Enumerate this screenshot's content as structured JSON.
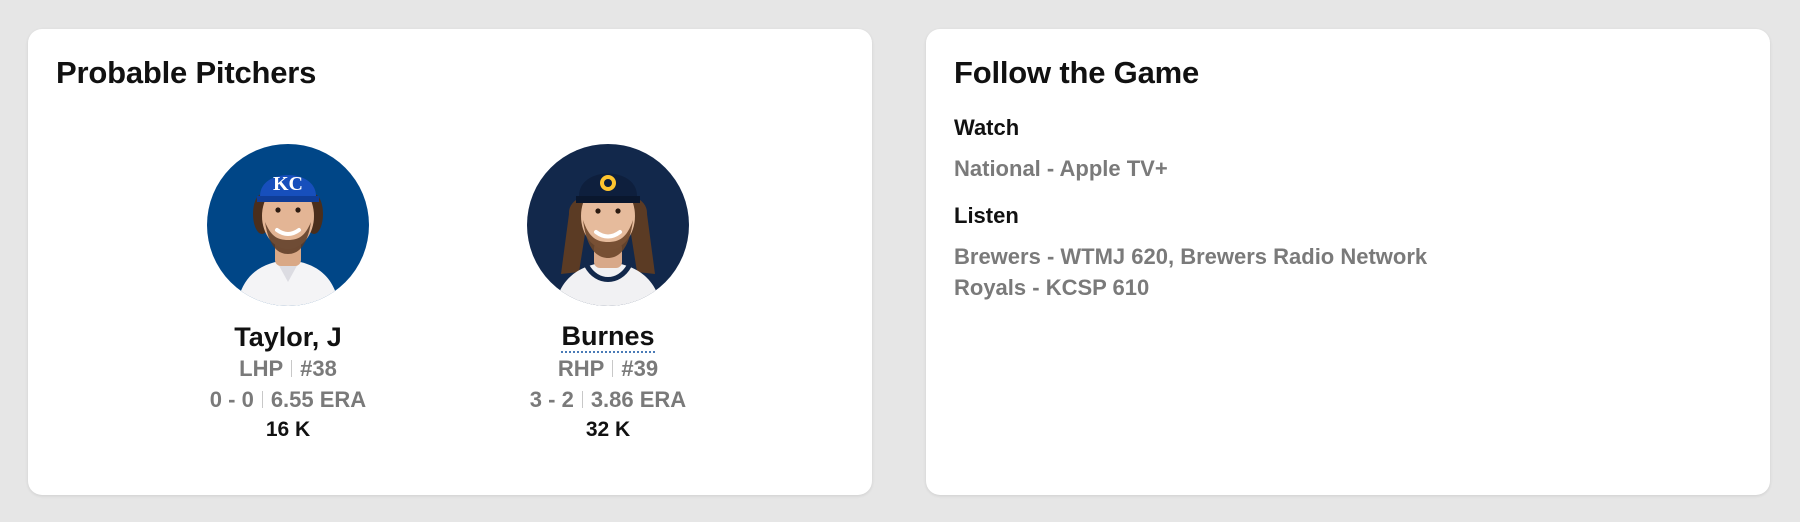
{
  "colors": {
    "page_background": "#e6e6e6",
    "card_background": "#ffffff",
    "muted_text": "#7a7a7a",
    "royals_blue": "#004687",
    "brewers_navy": "#12284b"
  },
  "pitchers_card": {
    "title": "Probable Pitchers",
    "pitchers": [
      {
        "name": "Taylor, J",
        "throws": "LHP",
        "number": "#38",
        "record": "0 - 0",
        "era": "6.55 ERA",
        "strikeouts": "16 K",
        "photo_icon": "royals-player-headshot",
        "cap_logo": "KC"
      },
      {
        "name": "Burnes",
        "throws": "RHP",
        "number": "#39",
        "record": "3 - 2",
        "era": "3.86 ERA",
        "strikeouts": "32 K",
        "photo_icon": "brewers-player-headshot"
      }
    ]
  },
  "follow_card": {
    "title": "Follow the Game",
    "watch": {
      "heading": "Watch",
      "lines": [
        "National - Apple TV+"
      ]
    },
    "listen": {
      "heading": "Listen",
      "lines": [
        "Brewers - WTMJ 620, Brewers Radio Network",
        "Royals - KCSP 610"
      ]
    }
  }
}
